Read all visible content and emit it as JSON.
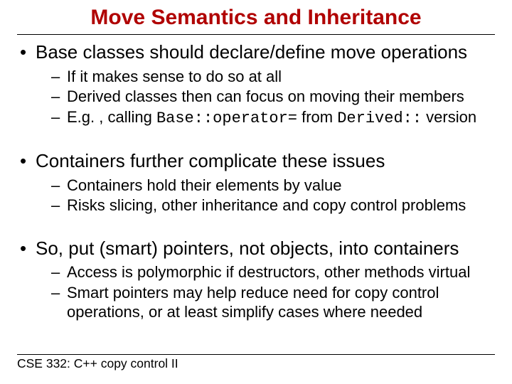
{
  "title": "Move Semantics and Inheritance",
  "bullets": [
    {
      "text": "Base classes should declare/define move operations",
      "sub": [
        {
          "text": "If it makes sense to do so at all"
        },
        {
          "text": "Derived classes then can focus on moving their members"
        },
        {
          "pre": "E.g. , calling ",
          "code1": "Base::operator=",
          "mid": " from ",
          "code2": "Derived::",
          "post": " version"
        }
      ]
    },
    {
      "text": "Containers further complicate these issues",
      "sub": [
        {
          "text": "Containers hold their elements by value"
        },
        {
          "text": "Risks slicing, other inheritance and copy control problems"
        }
      ]
    },
    {
      "text": "So, put (smart) pointers, not objects, into containers",
      "sub": [
        {
          "text": "Access is polymorphic if destructors, other methods virtual"
        },
        {
          "text": "Smart pointers may help reduce need for copy control operations, or at least simplify cases where needed"
        }
      ]
    }
  ],
  "footer": "CSE 332: C++ copy control II"
}
